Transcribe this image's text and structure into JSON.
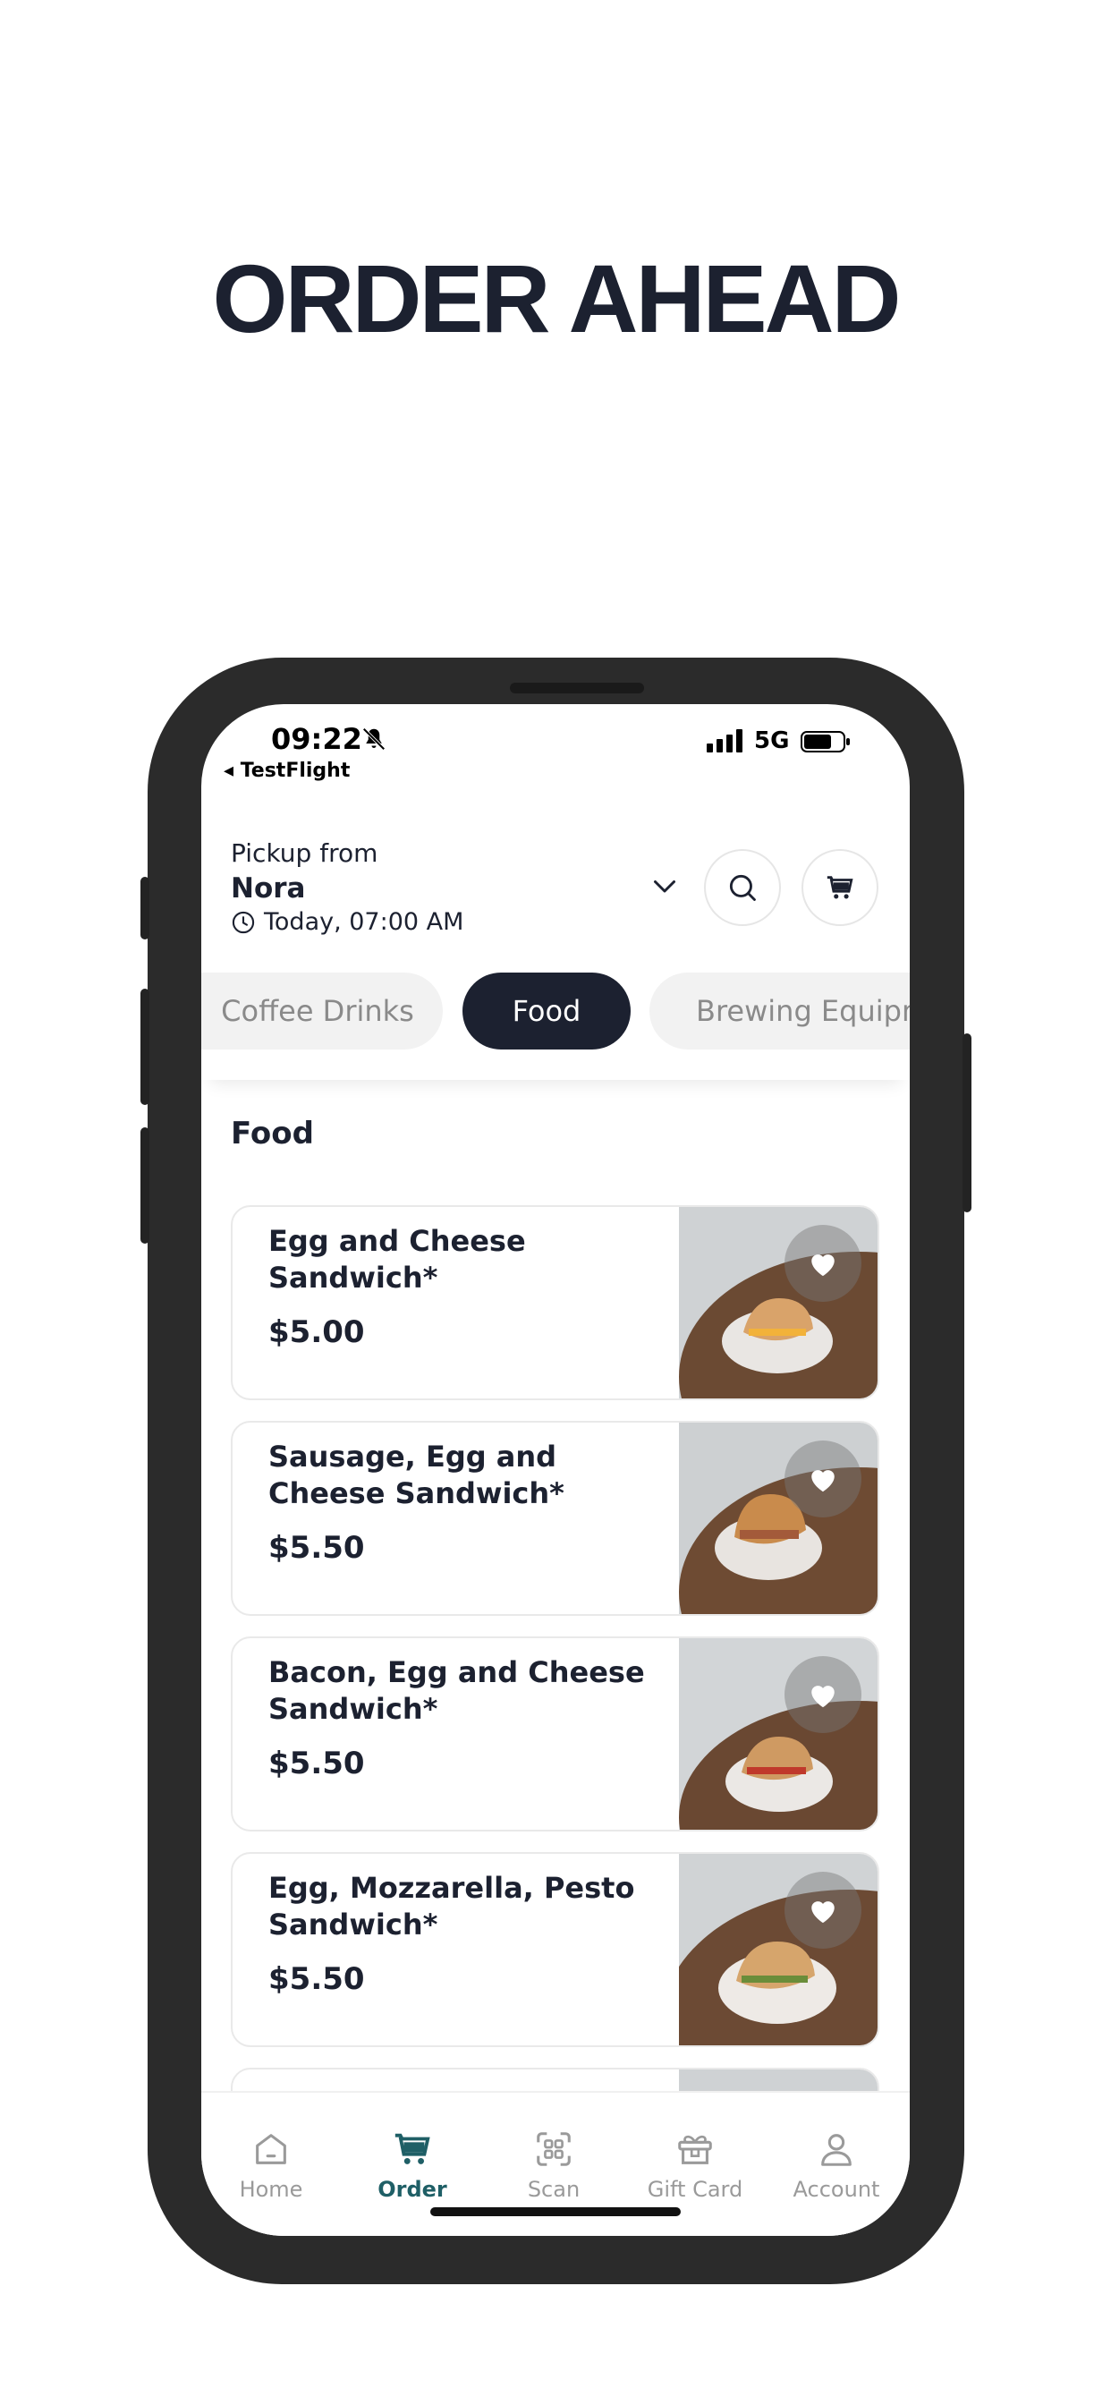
{
  "headline": "ORDER AHEAD",
  "status_bar": {
    "time": "09:22",
    "back_app": "◂ TestFlight",
    "network": "5G"
  },
  "header": {
    "pickup_label": "Pickup from",
    "store": "Nora",
    "time": "Today, 07:00 AM"
  },
  "tabs": [
    "Coffee Drinks",
    "Food",
    "Brewing Equipment"
  ],
  "active_tab": "Food",
  "section_title": "Food",
  "items": [
    {
      "name": "Egg and Cheese Sandwich*",
      "price": "$5.00"
    },
    {
      "name": "Sausage, Egg and Cheese Sandwich*",
      "price": "$5.50"
    },
    {
      "name": "Bacon, Egg and Cheese Sandwich*",
      "price": "$5.50"
    },
    {
      "name": "Egg, Mozzarella, Pesto Sandwich*",
      "price": "$5.50"
    }
  ],
  "nav": [
    {
      "label": "Home",
      "icon": "home-icon"
    },
    {
      "label": "Order",
      "icon": "order-cart-icon"
    },
    {
      "label": "Scan",
      "icon": "scan-icon"
    },
    {
      "label": "Gift Card",
      "icon": "gift-card-icon"
    },
    {
      "label": "Account",
      "icon": "account-icon"
    }
  ],
  "colors": {
    "primary": "#1c2130",
    "accent": "#1f5f66",
    "chip_bg": "#f2f2f2"
  }
}
